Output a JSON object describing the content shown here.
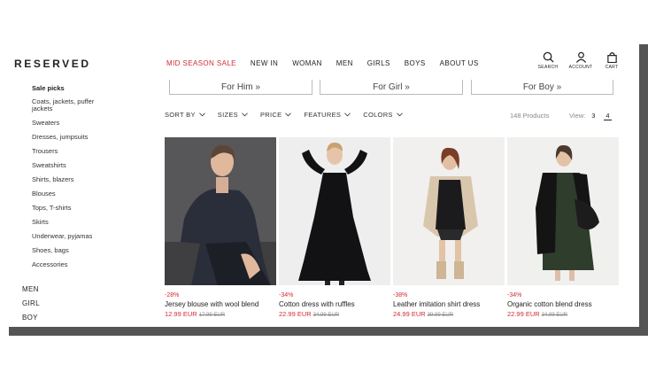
{
  "header": {
    "logo": "RESERVED",
    "nav": [
      "MID SEASON SALE",
      "NEW IN",
      "WOMAN",
      "MEN",
      "GIRLS",
      "BOYS",
      "ABOUT US"
    ],
    "icons": [
      {
        "icon": "search-icon",
        "label": "SEARCH"
      },
      {
        "icon": "account-icon",
        "label": "ACCOUNT"
      },
      {
        "icon": "cart-icon",
        "label": "CART"
      }
    ]
  },
  "sidebar": {
    "items": [
      "Sale picks",
      "Coats, jackets, puffer jackets",
      "Sweaters",
      "Dresses, jumpsuits",
      "Trousers",
      "Sweatshirts",
      "Shirts, blazers",
      "Blouses",
      "Tops, T-shirts",
      "Skirts",
      "Underwear, pyjamas",
      "Shoes, bags",
      "Accessories"
    ],
    "top_level": [
      "MEN",
      "GIRL",
      "BOY"
    ]
  },
  "gender_buttons": [
    "For Him »",
    "For Girl »",
    "For Boy »"
  ],
  "filters": [
    "SORT BY",
    "SIZES",
    "PRICE",
    "FEATURES",
    "COLORS"
  ],
  "product_count": "148 Products",
  "view": {
    "label": "View:",
    "options": [
      "3",
      "4"
    ],
    "selected": "4"
  },
  "products": [
    {
      "discount": "-28%",
      "name": "Jersey blouse with wool blend",
      "price": "12.99 EUR",
      "old_price": "17.99 EUR"
    },
    {
      "discount": "-34%",
      "name": "Cotton dress with ruffles",
      "price": "22.99 EUR",
      "old_price": "34.99 EUR"
    },
    {
      "discount": "-38%",
      "name": "Leather imitation shirt dress",
      "price": "24.99 EUR",
      "old_price": "39.99 EUR"
    },
    {
      "discount": "-34%",
      "name": "Organic cotton blend dress",
      "price": "22.99 EUR",
      "old_price": "34.99 EUR"
    }
  ],
  "colors": {
    "sale_red": "#d02b35",
    "text": "#222222",
    "frame": "#555555"
  }
}
